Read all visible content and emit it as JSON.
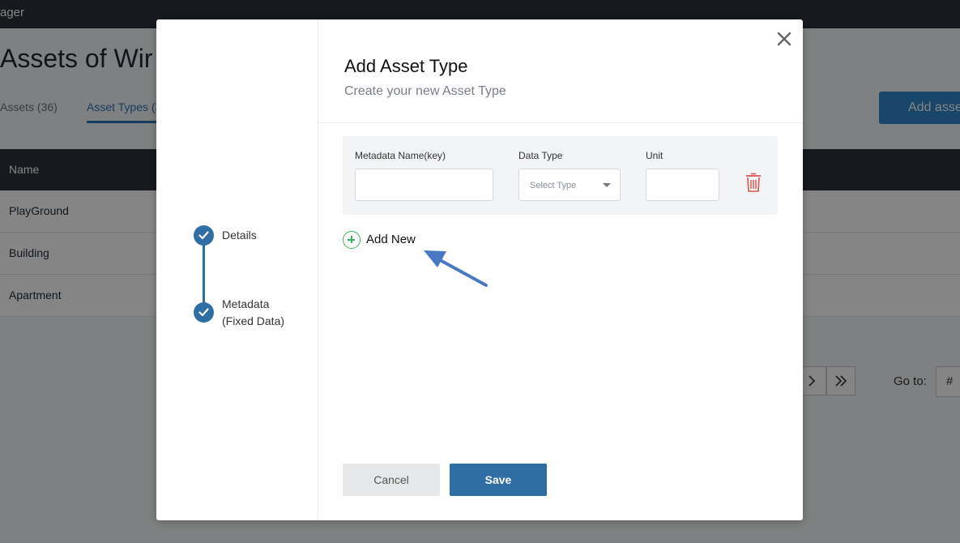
{
  "app": {
    "title_fragment": "ager"
  },
  "page": {
    "title": "Assets of Wir",
    "tabs": [
      {
        "label": "Assets (36)"
      },
      {
        "label": "Asset Types (3"
      }
    ],
    "add_button_label": "Add asse",
    "table": {
      "header": "Name",
      "rows": [
        "PlayGround",
        "Building",
        "Apartment"
      ]
    },
    "pagination": {
      "next_icon": "chevron-right-icon",
      "last_icon": "double-chevron-right-icon",
      "goto_label": "Go to:",
      "goto_placeholder": "#"
    }
  },
  "modal": {
    "close_icon": "close-icon",
    "title": "Add Asset Type",
    "subtitle": "Create your new Asset Type",
    "steps": [
      {
        "label": "Details",
        "completed": true
      },
      {
        "label": "Metadata (Fixed Data)",
        "completed": true
      }
    ],
    "metadata": {
      "name_label": "Metadata Name(key)",
      "type_label": "Data Type",
      "unit_label": "Unit",
      "name_value": "",
      "type_placeholder": "Select Type",
      "unit_value": "",
      "delete_icon": "trash-icon"
    },
    "add_new_label": "Add New",
    "cancel_label": "Cancel",
    "save_label": "Save",
    "colors": {
      "primary": "#2f6ea5",
      "add_green": "#3bb55a",
      "delete_red": "#d9534f",
      "annotation_arrow": "#4a78c2"
    }
  }
}
